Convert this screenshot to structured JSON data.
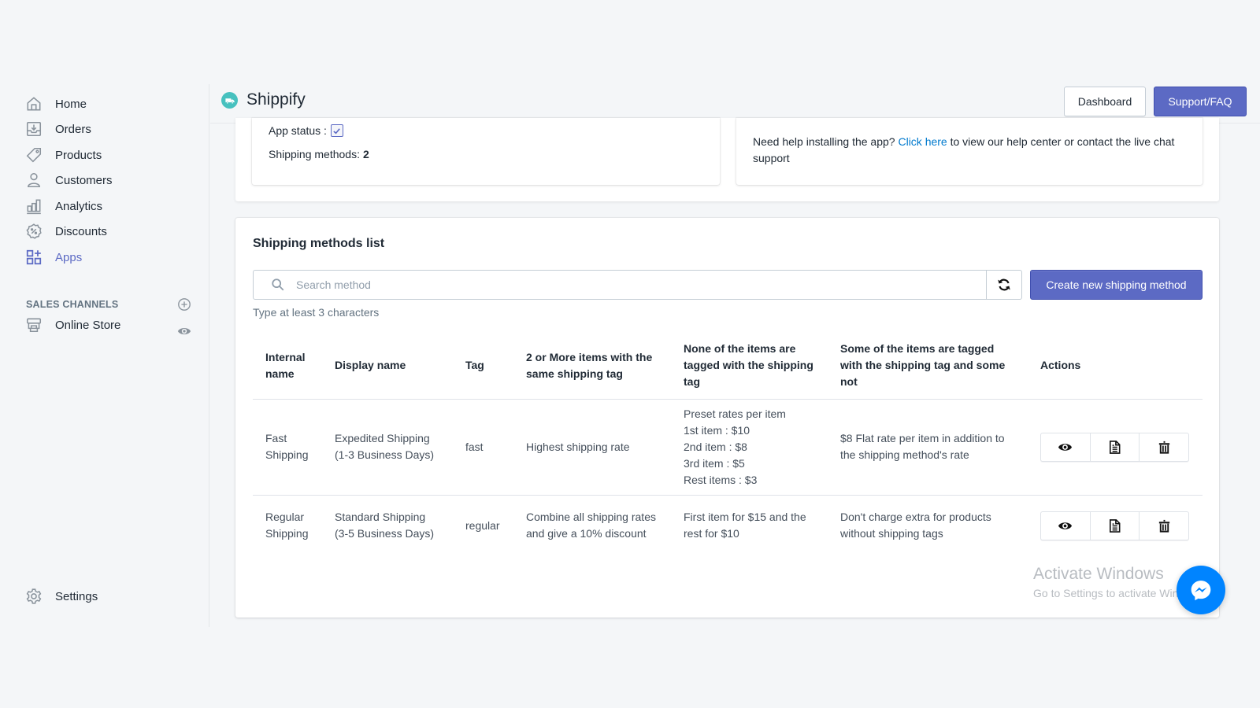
{
  "sidebar": {
    "items": [
      {
        "label": "Home",
        "icon": "home-icon"
      },
      {
        "label": "Orders",
        "icon": "orders-icon"
      },
      {
        "label": "Products",
        "icon": "tag-icon"
      },
      {
        "label": "Customers",
        "icon": "person-icon"
      },
      {
        "label": "Analytics",
        "icon": "bar-chart-icon"
      },
      {
        "label": "Discounts",
        "icon": "discount-icon"
      },
      {
        "label": "Apps",
        "icon": "apps-icon",
        "active": true
      }
    ],
    "sales_channels_title": "SALES CHANNELS",
    "channels": [
      {
        "label": "Online Store",
        "icon": "store-icon"
      }
    ],
    "settings_label": "Settings"
  },
  "header": {
    "app_title": "Shippify",
    "dashboard_label": "Dashboard",
    "support_label": "Support/FAQ"
  },
  "status": {
    "app_status_label": "App status :",
    "app_status_checked": true,
    "shipping_methods_label": "Shipping methods:",
    "shipping_methods_count": "2"
  },
  "help": {
    "before_link": "Need help installing the app? ",
    "link_text": "Click here",
    "after_link": " to view our help center or contact the live chat support"
  },
  "list": {
    "title": "Shipping methods list",
    "search_placeholder": "Search method",
    "search_value": "",
    "hint": "Type at least 3 characters",
    "create_label": "Create new shipping method",
    "columns": [
      "Internal name",
      "Display name",
      "Tag",
      "2 or More items with the same shipping tag",
      "None of the items are tagged with the shipping tag",
      "Some of the items are tagged with the shipping tag and some not",
      "Actions"
    ],
    "rows": [
      {
        "internal_name": "Fast Shipping",
        "display_name": "Expedited Shipping (1-3 Business Days)",
        "tag": "fast",
        "two_or_more": "Highest shipping rate",
        "none_tagged": [
          "Preset rates per item",
          "1st item : $10",
          "2nd item : $8",
          "3rd item : $5",
          "Rest items : $3"
        ],
        "some_tagged": "$8 Flat rate per item in addition to the shipping method's rate"
      },
      {
        "internal_name": "Regular Shipping",
        "display_name": "Standard Shipping (3-5 Business Days)",
        "tag": "regular",
        "two_or_more": "Combine all shipping rates and give a 10% discount",
        "none_tagged": [
          "First item for $15 and the rest for $10"
        ],
        "some_tagged": "Don't charge extra for products without shipping tags"
      }
    ]
  },
  "overlay": {
    "activate_title": "Activate Windows",
    "activate_sub": "Go to Settings to activate Windows."
  },
  "colors": {
    "accent": "#5c6ac4",
    "link": "#007ace",
    "logo": "#47c1bf",
    "messenger": "#0084ff"
  }
}
